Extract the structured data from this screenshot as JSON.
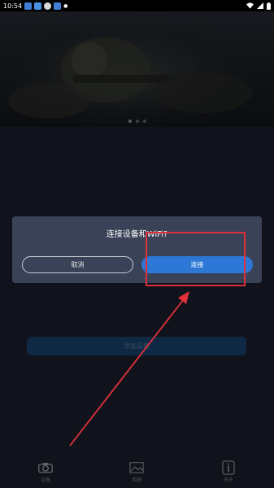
{
  "status_bar": {
    "time": "10:54",
    "indicators": [
      "notification-icon",
      "mail-icon",
      "blocked-icon",
      "shield-icon",
      "dot"
    ]
  },
  "banner": {
    "slide_count": 3,
    "active_slide": 1
  },
  "main": {
    "add_device_label": "添加设备"
  },
  "dialog": {
    "title": "连接设备和WiFi?",
    "cancel_label": "取消",
    "connect_label": "连接"
  },
  "bottom_nav": {
    "items": [
      {
        "label": "设备",
        "icon": "camera-icon"
      },
      {
        "label": "相册",
        "icon": "gallery-icon"
      },
      {
        "label": "关于",
        "icon": "info-icon"
      }
    ]
  },
  "colors": {
    "background": "#1f2433",
    "dialog": "#3a4257",
    "accent": "#2d78d6",
    "highlight": "#e0303a"
  }
}
